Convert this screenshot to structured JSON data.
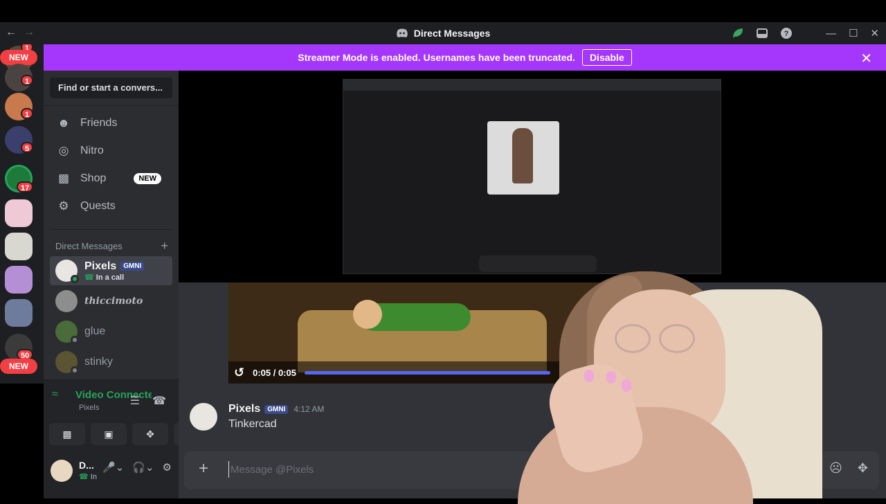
{
  "window": {
    "title": "Direct Messages",
    "back_icon": "arrow-left-icon",
    "forward_icon": "arrow-right-icon"
  },
  "banner": {
    "text": "Streamer Mode is enabled. Usernames have been truncated.",
    "button": "Disable",
    "color": "#a537fd"
  },
  "guild_rail": {
    "new_label": "NEW",
    "badges": [
      "1",
      "1",
      "1",
      "5",
      "17",
      "50"
    ]
  },
  "sidebar": {
    "search_placeholder": "Find or start a convers...",
    "nav": [
      {
        "label": "Friends",
        "icon": "friends-icon"
      },
      {
        "label": "Nitro",
        "icon": "nitro-icon"
      },
      {
        "label": "Shop",
        "icon": "shop-icon",
        "tag": "NEW"
      },
      {
        "label": "Quests",
        "icon": "quests-icon"
      }
    ],
    "dm_header": "Direct Messages",
    "dms": [
      {
        "name": "Pixels",
        "badge": "GMNI",
        "sub": "In a call"
      },
      {
        "name": "thiccimoto"
      },
      {
        "name": "glue"
      },
      {
        "name": "stinky"
      }
    ]
  },
  "voice": {
    "status": "Video Connected",
    "channel": "Pixels"
  },
  "user_panel": {
    "name": "D...",
    "status": "In"
  },
  "video_player": {
    "time": "0:05 / 0:05",
    "progress": 1.0
  },
  "message": {
    "author": "Pixels",
    "badge": "GMNI",
    "time": "4:12 AM",
    "text": "Tinkercad"
  },
  "composer": {
    "placeholder": "Message @Pixels"
  },
  "colors": {
    "accent": "#5865f2",
    "online": "#23a55a",
    "danger": "#f23f43"
  }
}
